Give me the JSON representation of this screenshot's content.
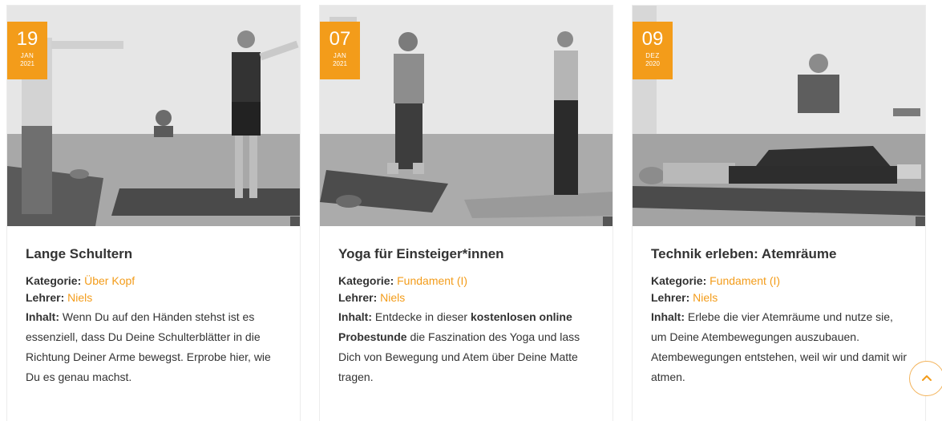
{
  "labels": {
    "category": "Kategorie:",
    "teacher": "Lehrer:",
    "content": "Inhalt:"
  },
  "accent_color": "#f39c1a",
  "posts": [
    {
      "date": {
        "day": "19",
        "month": "JAN",
        "year": "2021"
      },
      "title": "Lange Schultern",
      "category": "Über Kopf",
      "teacher": "Niels",
      "content": "Wenn Du auf den Händen stehst ist es essenziell, dass Du Deine Schulterblätter in die Richtung Deiner Arme bewegst. Erprobe hier, wie Du es genau machst."
    },
    {
      "date": {
        "day": "07",
        "month": "JAN",
        "year": "2021"
      },
      "title": "Yoga für Einsteiger*innen",
      "category": "Fundament (I)",
      "teacher": "Niels",
      "content_parts": {
        "pre": "Entdecke in dieser",
        "bold": "kostenlosen online Probestunde",
        "post": "die Faszination des Yoga und lass Dich von Bewegung und Atem über Deine Matte tragen."
      }
    },
    {
      "date": {
        "day": "09",
        "month": "DEZ",
        "year": "2020"
      },
      "title": "Technik erleben: Atemräume",
      "category": "Fundament (I)",
      "teacher": "Niels",
      "content": "Erlebe die vier Atemräume und nutze sie, um Deine Atembewegungen auszubauen. Atembewegungen entstehen, weil wir und damit wir atmen."
    }
  ],
  "icons": {
    "scroll_top": "chevron-up-icon"
  }
}
